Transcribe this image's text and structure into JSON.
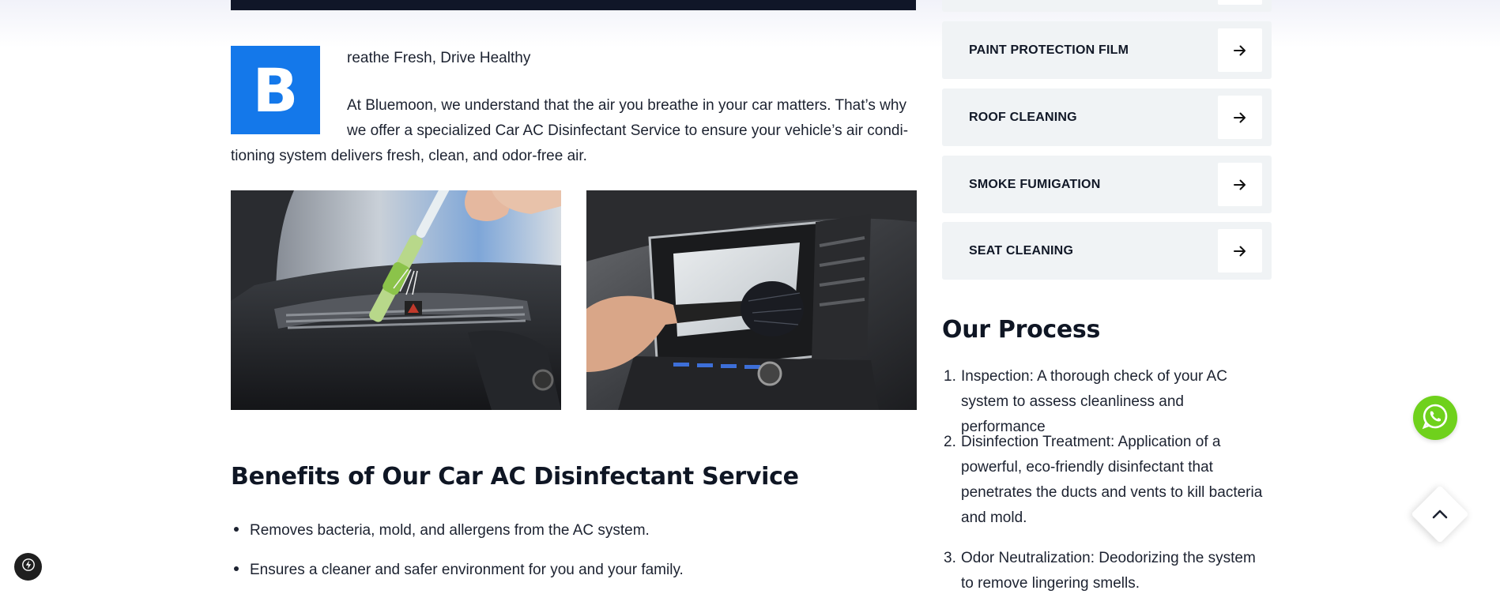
{
  "article": {
    "dropcap_letter": "B",
    "intro_title": "reathe Fresh, Drive Healthy",
    "intro_lines": [
      "At Bluemoon, we understand that the air you breathe in your car matters. That’s why",
      "we offer a specialized Car AC Disinfectant Service to ensure your vehicle’s air condi-",
      "tioning system delivers fresh, clean, and odor-free air."
    ],
    "photos": [
      {
        "icon": "car-vent-brush-photo"
      },
      {
        "icon": "dashboard-vent-brush-photo"
      }
    ],
    "benefits_title": "Benefits of Our Car AC Disinfectant Service",
    "benefits": [
      "Removes bacteria, mold, and allergens from the AC system.",
      "Ensures a cleaner and safer environment for you and your family."
    ]
  },
  "sidebar": {
    "services": [
      {
        "label": "PAINT PROTECTION FILM",
        "icon": "arrow-right-icon"
      },
      {
        "label": "ROOF CLEANING",
        "icon": "arrow-right-icon"
      },
      {
        "label": "SMOKE FUMIGATION",
        "icon": "arrow-right-icon"
      },
      {
        "label": "SEAT CLEANING",
        "icon": "arrow-right-icon"
      }
    ],
    "process_title": "Our Process",
    "process_steps": [
      {
        "num": "1.",
        "lines": [
          "Inspection: A thorough check of your AC",
          "system to assess cleanliness and performance"
        ]
      },
      {
        "num": "2.",
        "lines": [
          "Disinfection Treatment: Application of a",
          "powerful, eco-friendly disinfectant that",
          "penetrates the ducts and vents to kill bacteria",
          "and mold."
        ]
      },
      {
        "num": "3.",
        "lines": [
          "Odor Neutralization: Deodorizing the system",
          "to remove lingering smells."
        ]
      }
    ]
  },
  "floating": {
    "whatsapp_icon": "whatsapp-icon",
    "scroll_top_icon": "chevron-up-icon",
    "bolt_icon": "bolt-icon"
  },
  "colors": {
    "accent_blue": "#1478ea",
    "whatsapp_green": "#6fd11c",
    "service_bg": "#f0f3f5"
  }
}
